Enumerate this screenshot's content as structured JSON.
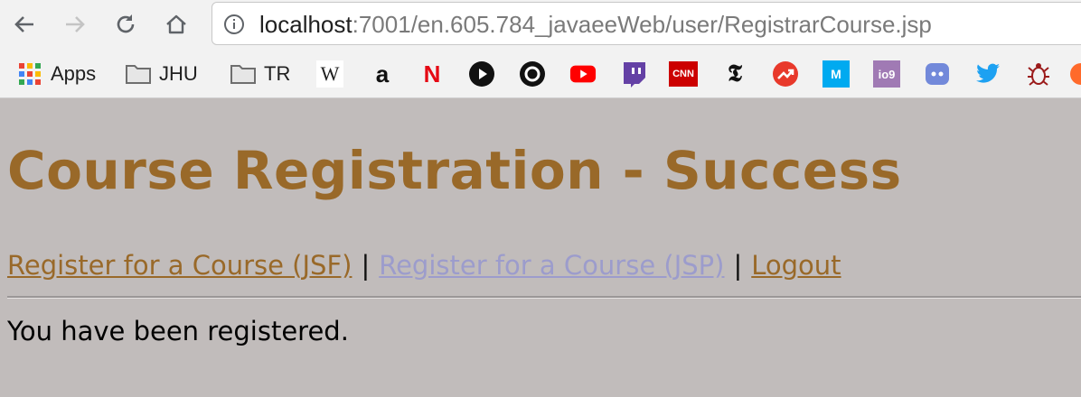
{
  "browser": {
    "url_host": "localhost",
    "url_rest": ":7001/en.605.784_javaeeWeb/user/RegistrarCourse.jsp"
  },
  "bookmarks": [
    {
      "label": "Apps",
      "icon": "apps-grid-icon"
    },
    {
      "label": "JHU",
      "icon": "folder-icon"
    },
    {
      "label": "TR",
      "icon": "folder-icon"
    },
    {
      "label": "",
      "icon": "wikipedia-icon"
    },
    {
      "label": "",
      "icon": "amazon-icon"
    },
    {
      "label": "",
      "icon": "netflix-icon"
    },
    {
      "label": "",
      "icon": "play-icon"
    },
    {
      "label": "",
      "icon": "circle-icon"
    },
    {
      "label": "",
      "icon": "youtube-icon"
    },
    {
      "label": "",
      "icon": "twitch-icon"
    },
    {
      "label": "",
      "icon": "cnn-icon"
    },
    {
      "label": "",
      "icon": "nytimes-icon"
    },
    {
      "label": "",
      "icon": "trending-icon"
    },
    {
      "label": "",
      "icon": "medium-icon"
    },
    {
      "label": "",
      "icon": "io9-icon"
    },
    {
      "label": "",
      "icon": "discord-icon"
    },
    {
      "label": "",
      "icon": "twitter-icon"
    },
    {
      "label": "",
      "icon": "bug-icon"
    }
  ],
  "bookmark_glyphs": {
    "wikipedia": "W",
    "amazon": "a",
    "netflix": "N",
    "cnn": "CNN",
    "nytimes": "𝕿",
    "medium": "M",
    "io9": "io9"
  },
  "page": {
    "title": "Course Registration - Success",
    "links": {
      "jsf": "Register for a Course (JSF)",
      "jsp": "Register for a Course (JSP)",
      "logout": "Logout",
      "separator": "|"
    },
    "message": "You have been registered."
  },
  "colors": {
    "background": "#c1bcbb",
    "heading": "#996929",
    "visited_link": "#996929",
    "unvisited_link": "#9c9ccc"
  }
}
